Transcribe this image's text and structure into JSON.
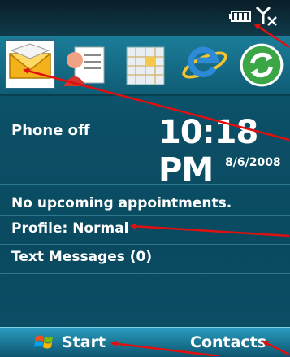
{
  "status_bar": {
    "icons": [
      "battery-icon",
      "signal-off-icon"
    ]
  },
  "app_icons": [
    {
      "name": "messaging-icon"
    },
    {
      "name": "contacts-card-icon"
    },
    {
      "name": "calendar-icon"
    },
    {
      "name": "internet-explorer-icon"
    },
    {
      "name": "activesync-icon"
    }
  ],
  "today": {
    "phone_status": "Phone off",
    "time": "10:18 PM",
    "date": "8/6/2008",
    "appointments": "No upcoming appointments.",
    "profile": "Profile: Normal",
    "text_messages": "Text Messages (0)"
  },
  "softkeys": {
    "left": "Start",
    "right": "Contacts"
  },
  "colors": {
    "background": "#0b4f66",
    "softkey_bar": "#1b7896",
    "annotation_arrow": "#e01010"
  }
}
